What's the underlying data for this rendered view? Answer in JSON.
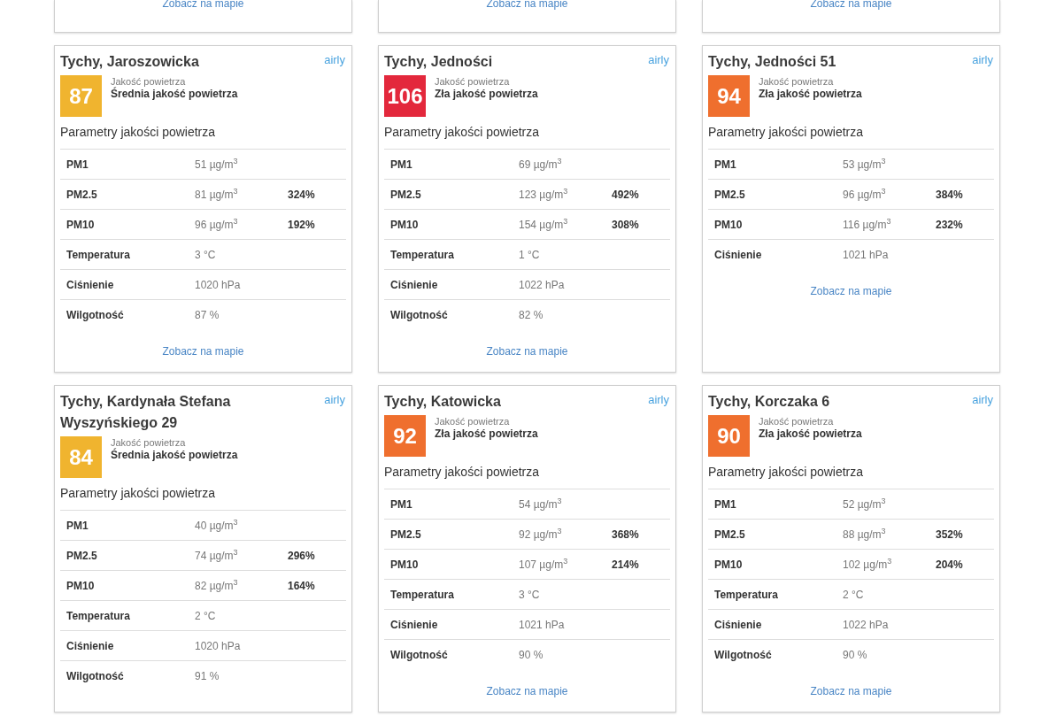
{
  "partial_cards": [
    {
      "link": "Zobacz na mapie"
    },
    {
      "link": "Zobacz na mapie"
    },
    {
      "link": "Zobacz na mapie"
    }
  ],
  "cards": [
    {
      "title": "Tychy, Jaroszowicka",
      "logo": "airly",
      "index": "87",
      "color": "#f0b42f",
      "caption": "Jakość powietrza",
      "quality": "Średnia jakość powietrza",
      "section": "Parametry jakości powietrza",
      "params": [
        {
          "label": "PM1",
          "value": "51 µg/m$^{3}$"
        },
        {
          "label": "PM2.5",
          "value": "81 µg/m$^{3}$",
          "percent": "324%"
        },
        {
          "label": "PM10",
          "value": "96 µg/m$^{3}$",
          "percent": "192%"
        },
        {
          "label": "Temperatura",
          "value": "3 °C"
        },
        {
          "label": "Ciśnienie",
          "value": "1020 hPa"
        },
        {
          "label": "Wilgotność",
          "value": "87 %"
        }
      ],
      "link": "Zobacz na mapie"
    },
    {
      "title": "Tychy, Jedności",
      "logo": "airly",
      "index": "106",
      "color": "#e3283c",
      "caption": "Jakość powietrza",
      "quality": "Zła jakość powietrza",
      "section": "Parametry jakości powietrza",
      "params": [
        {
          "label": "PM1",
          "value": "69 µg/m$^{3}$"
        },
        {
          "label": "PM2.5",
          "value": "123 µg/m$^{3}$",
          "percent": "492%"
        },
        {
          "label": "PM10",
          "value": "154 µg/m$^{3}$",
          "percent": "308%"
        },
        {
          "label": "Temperatura",
          "value": "1 °C"
        },
        {
          "label": "Ciśnienie",
          "value": "1022 hPa"
        },
        {
          "label": "Wilgotność",
          "value": "82 %"
        }
      ],
      "link": "Zobacz na mapie"
    },
    {
      "title": "Tychy, Jedności 51",
      "logo": "airly",
      "index": "94",
      "color": "#ef6f2e",
      "caption": "Jakość powietrza",
      "quality": "Zła jakość powietrza",
      "section": "Parametry jakości powietrza",
      "params": [
        {
          "label": "PM1",
          "value": "53 µg/m$^{3}$"
        },
        {
          "label": "PM2.5",
          "value": "96 µg/m$^{3}$",
          "percent": "384%"
        },
        {
          "label": "PM10",
          "value": "116 µg/m$^{3}$",
          "percent": "232%"
        },
        {
          "label": "Ciśnienie",
          "value": "1021 hPa"
        }
      ],
      "link": "Zobacz na mapie"
    },
    {
      "title": "Tychy, Kardynała Stefana Wyszyńskiego 29",
      "logo": "airly",
      "index": "84",
      "color": "#f0b42f",
      "caption": "Jakość powietrza",
      "quality": "Średnia jakość powietrza",
      "section": "Parametry jakości powietrza",
      "params": [
        {
          "label": "PM1",
          "value": "40 µg/m$^{3}$"
        },
        {
          "label": "PM2.5",
          "value": "74 µg/m$^{3}$",
          "percent": "296%"
        },
        {
          "label": "PM10",
          "value": "82 µg/m$^{3}$",
          "percent": "164%"
        },
        {
          "label": "Temperatura",
          "value": "2 °C"
        },
        {
          "label": "Ciśnienie",
          "value": "1020 hPa"
        },
        {
          "label": "Wilgotność",
          "value": "91 %"
        }
      ]
    },
    {
      "title": "Tychy, Katowicka",
      "logo": "airly",
      "index": "92",
      "color": "#ef6f2e",
      "caption": "Jakość powietrza",
      "quality": "Zła jakość powietrza",
      "section": "Parametry jakości powietrza",
      "params": [
        {
          "label": "PM1",
          "value": "54 µg/m$^{3}$"
        },
        {
          "label": "PM2.5",
          "value": "92 µg/m$^{3}$",
          "percent": "368%"
        },
        {
          "label": "PM10",
          "value": "107 µg/m$^{3}$",
          "percent": "214%"
        },
        {
          "label": "Temperatura",
          "value": "3 °C"
        },
        {
          "label": "Ciśnienie",
          "value": "1021 hPa"
        },
        {
          "label": "Wilgotność",
          "value": "90 %"
        }
      ],
      "link": "Zobacz na mapie"
    },
    {
      "title": "Tychy, Korczaka 6",
      "logo": "airly",
      "index": "90",
      "color": "#ef6f2e",
      "caption": "Jakość powietrza",
      "quality": "Zła jakość powietrza",
      "section": "Parametry jakości powietrza",
      "params": [
        {
          "label": "PM1",
          "value": "52 µg/m$^{3}$"
        },
        {
          "label": "PM2.5",
          "value": "88 µg/m$^{3}$",
          "percent": "352%"
        },
        {
          "label": "PM10",
          "value": "102 µg/m$^{3}$",
          "percent": "204%"
        },
        {
          "label": "Temperatura",
          "value": "2 °C"
        },
        {
          "label": "Ciśnienie",
          "value": "1022 hPa"
        },
        {
          "label": "Wilgotność",
          "value": "90 %"
        }
      ],
      "link": "Zobacz na mapie"
    }
  ]
}
